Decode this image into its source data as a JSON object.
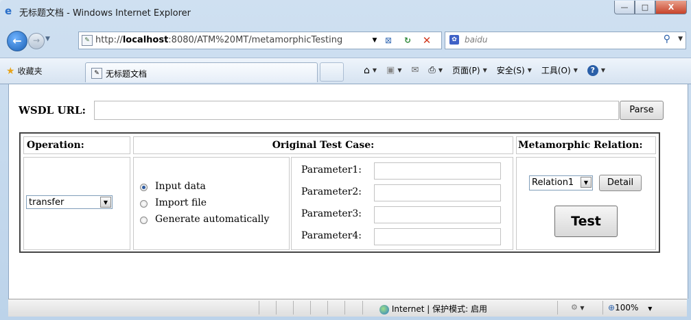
{
  "window": {
    "title": "无标题文档 - Windows Internet Explorer",
    "controls": {
      "minimize": "—",
      "maximize": "□",
      "close": "X"
    }
  },
  "address_bar": {
    "url_prefix": "http://",
    "url_host": "localhost",
    "url_rest": ":8080/ATM%20MT/metamorphicTesting"
  },
  "search": {
    "placeholder": "baidu"
  },
  "command_bar": {
    "favorites": "收藏夹",
    "tab_title": "无标题文档",
    "page_menu": "页面(P)",
    "safety_menu": "安全(S)",
    "tools_menu": "工具(O)"
  },
  "form": {
    "wsdl_label": "WSDL URL:",
    "wsdl_value": "",
    "parse_label": "Parse",
    "headers": {
      "operation": "Operation:",
      "original": "Original Test Case:",
      "relation": "Metamorphic Relation:"
    },
    "operation_value": "transfer",
    "radio_options": [
      "Input data",
      "Import file",
      "Generate automatically"
    ],
    "selected_radio": "Input data",
    "parameters": [
      "Parameter1:",
      "Parameter2:",
      "Parameter3:",
      "Parameter4:"
    ],
    "relation_value": "Relation1",
    "detail_label": "Detail",
    "test_label": "Test"
  },
  "status_bar": {
    "zone": "Internet | 保护模式: 启用",
    "zoom": "100%"
  },
  "colors": {
    "titlebar": "#cfe0f1",
    "accent": "#2a5fa8"
  }
}
